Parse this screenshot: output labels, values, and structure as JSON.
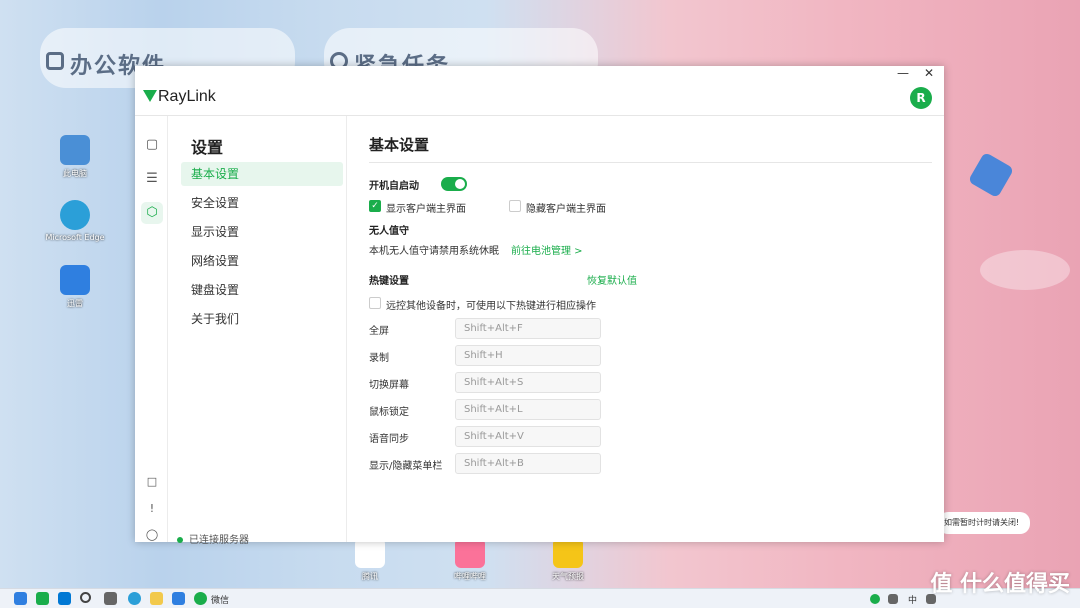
{
  "desktop": {
    "cards": [
      "办公软件",
      "紧急任务"
    ],
    "icons": [
      {
        "label": "此电脑"
      },
      {
        "label": "Microsoft Edge"
      },
      {
        "label": "迅雷"
      }
    ],
    "bottom_icons": [
      {
        "label": "腾讯"
      },
      {
        "label": "哔哩哔哩"
      },
      {
        "label": "天气预报"
      }
    ],
    "notification": "如需暂时计时请关闭!",
    "watermark": "值 什么值得买"
  },
  "window": {
    "brand": "RayLink",
    "avatar_letter": "R",
    "controls": {
      "minimize": "—",
      "close": "✕"
    },
    "nav": {
      "title": "设置",
      "items": [
        "基本设置",
        "安全设置",
        "显示设置",
        "网络设置",
        "键盘设置",
        "关于我们"
      ],
      "active_index": 0,
      "status": "已连接服务器"
    },
    "main": {
      "title": "基本设置",
      "autostart_label": "开机自启动",
      "autostart_on": true,
      "show_client_label": "显示客户端主界面",
      "show_client_checked": true,
      "hide_client_label": "隐藏客户端主界面",
      "hide_client_checked": false,
      "unattended_title": "无人值守",
      "unattended_desc": "本机无人值守请禁用系统休眠",
      "battery_link": "前往电池管理 >",
      "hotkey_title": "热键设置",
      "restore_default": "恢复默认值",
      "hotkey_enable_label": "远控其他设备时，可使用以下热键进行相应操作",
      "hotkey_enable_checked": false,
      "hotkeys": [
        {
          "label": "全屏",
          "value": "Shift+Alt+F"
        },
        {
          "label": "录制",
          "value": "Shift+H"
        },
        {
          "label": "切换屏幕",
          "value": "Shift+Alt+S"
        },
        {
          "label": "鼠标锁定",
          "value": "Shift+Alt+L"
        },
        {
          "label": "语音同步",
          "value": "Shift+Alt+V"
        },
        {
          "label": "显示/隐藏菜单栏",
          "value": "Shift+Alt+B"
        }
      ]
    }
  },
  "taskbar": {
    "wechat_label": "微信",
    "tray_ime": "中"
  },
  "colors": {
    "accent": "#1aad4b"
  }
}
